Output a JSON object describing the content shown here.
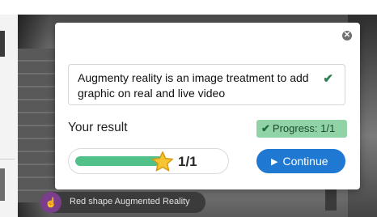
{
  "dialog": {
    "answer_text": "Augmenty reality is an image treatment to add graphic on real and live video",
    "answer_status_icon": "check-icon",
    "result_label": "Your result",
    "progress_label": "Progress: 1/1",
    "progress_fraction": 1.0,
    "score_text": "1/1",
    "continue_label": "Continue",
    "close_icon": "close-icon",
    "accent_color": "#1f78d1",
    "success_color": "#51c089"
  },
  "caption": {
    "text": "Red shape Augmented Reality",
    "icon": "hand-pointer-icon"
  }
}
